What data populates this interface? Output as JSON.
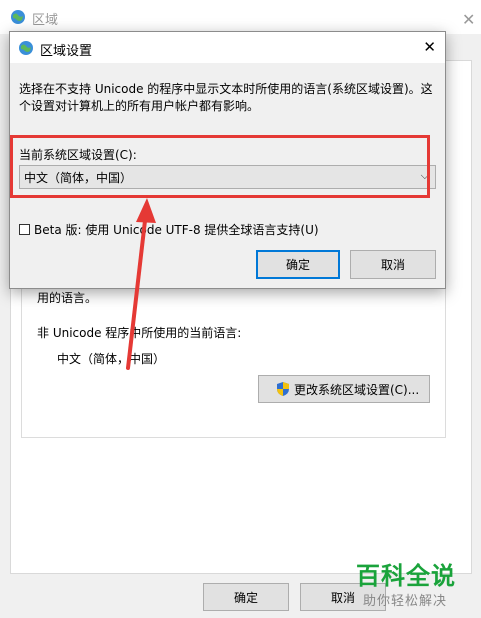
{
  "background_window": {
    "title": "区域",
    "close_glyph": "✕",
    "used_language_text": "用的语言。",
    "non_unicode_label": "非 Unicode 程序中所使用的当前语言:",
    "non_unicode_value": "中文（简体，中国）",
    "change_locale_button": "更改系统区域设置(C)...",
    "ok_button": "确定",
    "cancel_button": "取消"
  },
  "dialog": {
    "title": "区域设置",
    "close_glyph": "✕",
    "description_line1": "选择在不支持 Unicode 的程序中显示文本时所使用的语言(系统区域设置)。这",
    "description_line2": "个设置对计算机上的所有用户帐户都有影响。",
    "current_locale_label": "当前系统区域设置(C):",
    "current_locale_value": "中文（简体，中国）",
    "beta_checkbox_label": "Beta 版: 使用 Unicode UTF-8 提供全球语言支持(U)",
    "beta_checked": false,
    "ok_button": "确定",
    "cancel_button": "取消"
  },
  "watermark": {
    "main": "百科全说",
    "sub": "助你轻松解决"
  },
  "colors": {
    "annotation_red": "#e53935",
    "watermark_green": "#1aa33b",
    "focus_blue": "#0078d7"
  }
}
